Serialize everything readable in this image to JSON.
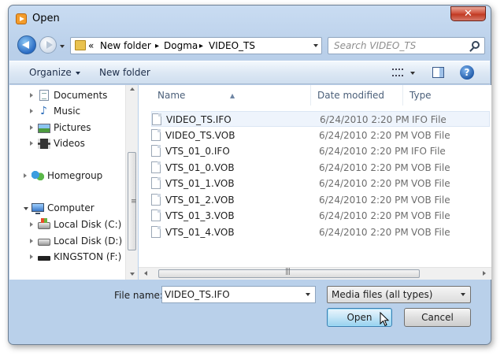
{
  "window": {
    "title": "Open",
    "close_glyph": "✕"
  },
  "address_bar": {
    "prefix": "«",
    "crumbs": [
      "New folder",
      "Dogma",
      "VIDEO_TS"
    ],
    "separator": "▸"
  },
  "search": {
    "placeholder": "Search VIDEO_TS"
  },
  "toolbar": {
    "organize": "Organize",
    "new_folder": "New folder",
    "help_glyph": "?"
  },
  "nav_pane": {
    "libraries": [
      {
        "label": "Documents",
        "icon": "documents-icon"
      },
      {
        "label": "Music",
        "icon": "music-icon"
      },
      {
        "label": "Pictures",
        "icon": "pictures-icon"
      },
      {
        "label": "Videos",
        "icon": "videos-icon"
      }
    ],
    "homegroup": {
      "label": "Homegroup",
      "icon": "homegroup-icon"
    },
    "computer": {
      "label": "Computer",
      "icon": "computer-icon",
      "drives": [
        {
          "label": "Local Disk (C:)",
          "icon": "system-drive-icon"
        },
        {
          "label": "Local Disk (D:)",
          "icon": "hard-drive-icon"
        },
        {
          "label": "KINGSTON (F:)",
          "icon": "usb-drive-icon"
        }
      ]
    }
  },
  "file_list": {
    "columns": [
      "Name",
      "Date modified",
      "Type"
    ],
    "rows": [
      {
        "name": "VIDEO_TS.IFO",
        "date": "6/24/2010 2:20 PM",
        "type": "IFO File",
        "selected": true
      },
      {
        "name": "VIDEO_TS.VOB",
        "date": "6/24/2010 2:20 PM",
        "type": "VOB File"
      },
      {
        "name": "VTS_01_0.IFO",
        "date": "6/24/2010 2:20 PM",
        "type": "IFO File"
      },
      {
        "name": "VTS_01_0.VOB",
        "date": "6/24/2010 2:20 PM",
        "type": "VOB File"
      },
      {
        "name": "VTS_01_1.VOB",
        "date": "6/24/2010 2:20 PM",
        "type": "VOB File"
      },
      {
        "name": "VTS_01_2.VOB",
        "date": "6/24/2010 2:20 PM",
        "type": "VOB File"
      },
      {
        "name": "VTS_01_3.VOB",
        "date": "6/24/2010 2:20 PM",
        "type": "VOB File"
      },
      {
        "name": "VTS_01_4.VOB",
        "date": "6/24/2010 2:20 PM",
        "type": "VOB File"
      }
    ]
  },
  "footer": {
    "file_name_label": "File name:",
    "file_name_value": "VIDEO_TS.IFO",
    "filter_value": "Media files (all types)",
    "open_label": "Open",
    "cancel_label": "Cancel"
  },
  "colors": {
    "accent": "#2b6cc4",
    "selection": "#eef4fc",
    "close": "#c13a23"
  }
}
